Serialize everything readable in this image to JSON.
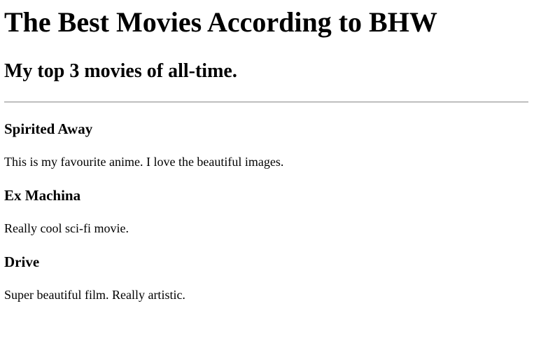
{
  "page": {
    "title": "The Best Movies According to BHW",
    "subtitle": "My top 3 movies of all-time."
  },
  "movies": [
    {
      "title": "Spirited Away",
      "description": "This is my favourite anime. I love the beautiful images."
    },
    {
      "title": "Ex Machina",
      "description": "Really cool sci-fi movie."
    },
    {
      "title": "Drive",
      "description": "Super beautiful film. Really artistic."
    }
  ]
}
